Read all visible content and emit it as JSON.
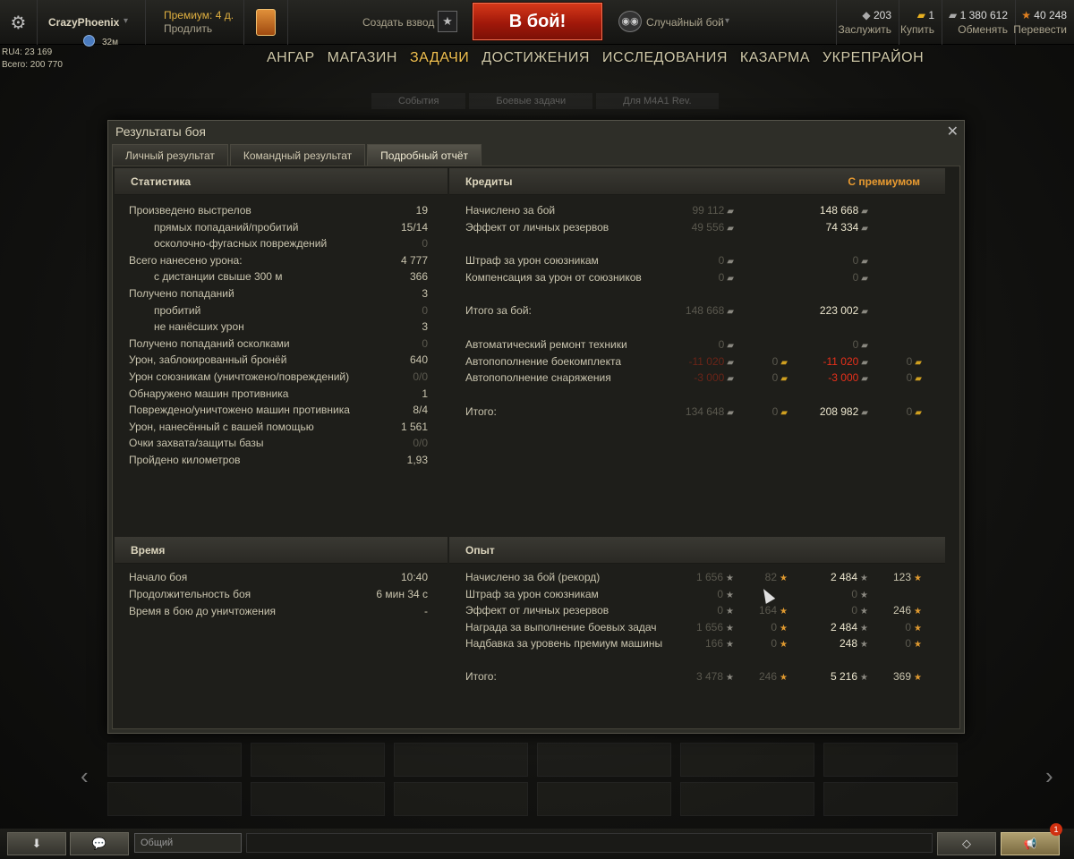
{
  "topbar": {
    "player_name": "CrazyPhoenix",
    "clan_time": "32м",
    "premium_label": "Премиум: 4 д.",
    "extend_label": "Продлить",
    "platoon_label": "Создать взвод",
    "battle_button": "В бой!",
    "mode_label": "Случайный бой",
    "currencies": [
      {
        "value": "203",
        "label": "Заслужить",
        "icon": "bonds-icon"
      },
      {
        "value": "1",
        "label": "Купить",
        "icon": "gold-icon"
      },
      {
        "value": "1 380 612",
        "label": "Обменять",
        "icon": "credits-icon"
      },
      {
        "value": "40 248",
        "label": "Перевести",
        "icon": "free-xp-icon"
      }
    ]
  },
  "account": {
    "ru4": "RU4: 23 169",
    "total": "Всего: 200 770"
  },
  "nav": [
    "АНГАР",
    "МАГАЗИН",
    "ЗАДАЧИ",
    "ДОСТИЖЕНИЯ",
    "ИССЛЕДОВАНИЯ",
    "КАЗАРМА",
    "УКРЕПРАЙОН"
  ],
  "nav_active": "ЗАДАЧИ",
  "subtabs": [
    "События",
    "Боевые задачи",
    "Для M4A1 Rev."
  ],
  "window": {
    "title": "Результаты боя",
    "tabs": [
      "Личный результат",
      "Командный результат",
      "Подробный отчёт"
    ],
    "active_tab": 2
  },
  "stats": {
    "header": "Статистика",
    "rows": [
      {
        "label": "Произведено выстрелов",
        "value": "19",
        "indent": false,
        "dim": false
      },
      {
        "label": "прямых попаданий/пробитий",
        "value": "15/14",
        "indent": true,
        "dim": false
      },
      {
        "label": "осколочно-фугасных повреждений",
        "value": "0",
        "indent": true,
        "dim": true
      },
      {
        "label": "Всего нанесено урона:",
        "value": "4 777",
        "indent": false,
        "dim": false
      },
      {
        "label": "с дистанции свыше 300 м",
        "value": "366",
        "indent": true,
        "dim": false
      },
      {
        "label": "Получено попаданий",
        "value": "3",
        "indent": false,
        "dim": false
      },
      {
        "label": "пробитий",
        "value": "0",
        "indent": true,
        "dim": true
      },
      {
        "label": "не нанёсших урон",
        "value": "3",
        "indent": true,
        "dim": false
      },
      {
        "label": "Получено попаданий осколками",
        "value": "0",
        "indent": false,
        "dim": true
      },
      {
        "label": "Урон, заблокированный бронёй",
        "value": "640",
        "indent": false,
        "dim": false
      },
      {
        "label": "Урон союзникам (уничтожено/повреждений)",
        "value": "0/0",
        "indent": false,
        "dim": true
      },
      {
        "label": "Обнаружено машин противника",
        "value": "1",
        "indent": false,
        "dim": false
      },
      {
        "label": "Повреждено/уничтожено машин противника",
        "value": "8/4",
        "indent": false,
        "dim": false
      },
      {
        "label": "Урон, нанесённый с вашей помощью",
        "value": "1 561",
        "indent": false,
        "dim": false
      },
      {
        "label": "Очки захвата/защиты базы",
        "value": "0/0",
        "indent": false,
        "dim": true
      },
      {
        "label": "Пройдено километров",
        "value": "1,93",
        "indent": false,
        "dim": false
      }
    ]
  },
  "credits": {
    "header": "Кредиты",
    "premium_header": "С премиумом",
    "rows": [
      {
        "label": "Начислено за бой",
        "a": "99 112",
        "b": "",
        "c": "148 668",
        "d": "",
        "gap_before": false
      },
      {
        "label": "Эффект от личных резервов",
        "a": "49 556",
        "b": "",
        "c": "74 334",
        "d": "",
        "gap_before": false
      },
      {
        "label": "Штраф за урон союзникам",
        "a": "0",
        "b": "",
        "c": "0",
        "d": "",
        "gap_before": true
      },
      {
        "label": "Компенсация за урон от союзников",
        "a": "0",
        "b": "",
        "c": "0",
        "d": "",
        "gap_before": false
      },
      {
        "label": "Итого за бой:",
        "a": "148 668",
        "b": "",
        "c": "223 002",
        "d": "",
        "gap_before": true
      },
      {
        "label": "Автоматический ремонт техники",
        "a": "0",
        "b": "",
        "c": "0",
        "d": "",
        "gap_before": true
      },
      {
        "label": "Автопополнение боекомплекта",
        "a": "-11 020",
        "b": "0",
        "c": "-11 020",
        "d": "0",
        "gap_before": false
      },
      {
        "label": "Автопополнение снаряжения",
        "a": "-3 000",
        "b": "0",
        "c": "-3 000",
        "d": "0",
        "gap_before": false
      },
      {
        "label": "Итого:",
        "a": "134 648",
        "b": "0",
        "c": "208 982",
        "d": "0",
        "gap_before": true
      }
    ]
  },
  "time": {
    "header": "Время",
    "rows": [
      {
        "label": "Начало боя",
        "value": "10:40"
      },
      {
        "label": "Продолжительность боя",
        "value": "6 мин 34 с"
      },
      {
        "label": "Время в бою до уничтожения",
        "value": "-"
      }
    ]
  },
  "xp": {
    "header": "Опыт",
    "rows": [
      {
        "label": "Начислено за бой (рекорд)",
        "a": "1 656",
        "b": "82",
        "c": "2 484",
        "d": "123"
      },
      {
        "label": "Штраф за урон союзникам",
        "a": "0",
        "b": "",
        "c": "0",
        "d": ""
      },
      {
        "label": "Эффект от личных резервов",
        "a": "0",
        "b": "164",
        "c": "0",
        "d": "246"
      },
      {
        "label": "Награда за выполнение боевых задач",
        "a": "1 656",
        "b": "0",
        "c": "2 484",
        "d": "0"
      },
      {
        "label": "Надбавка за уровень премиум машины",
        "a": "166",
        "b": "0",
        "c": "248",
        "d": "0"
      },
      {
        "label": "Итого:",
        "a": "3 478",
        "b": "246",
        "c": "5 216",
        "d": "369"
      }
    ]
  },
  "chat": {
    "channel": "Общий",
    "badge": "1"
  }
}
